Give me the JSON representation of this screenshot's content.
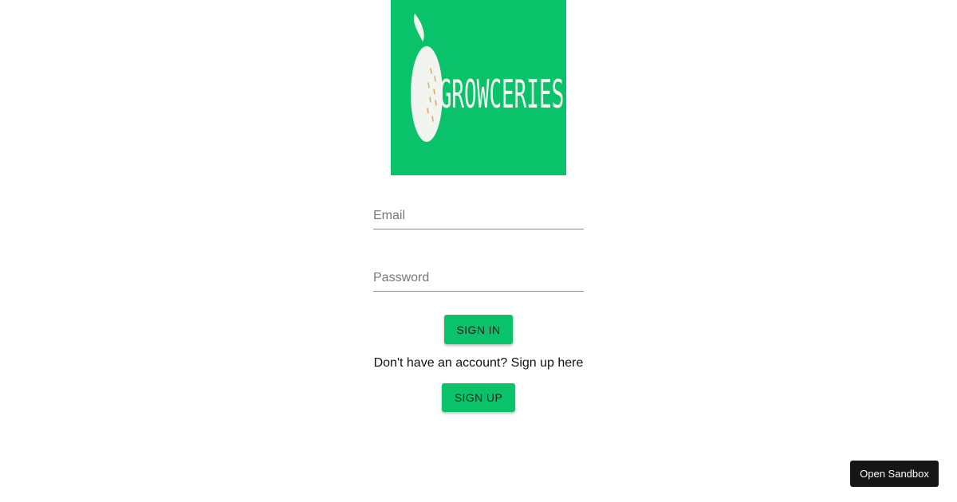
{
  "logo": {
    "wordmark": "GROWCERIES",
    "background": "#0ac26a",
    "icon": "fruit-icon"
  },
  "form": {
    "email_placeholder": "Email",
    "password_placeholder": "Password",
    "signin_label": "SIGN IN",
    "signup_prompt": "Don't have an account? Sign up here",
    "signup_label": "SIGN UP"
  },
  "sandbox": {
    "label": "Open Sandbox"
  },
  "colors": {
    "accent": "#0ac26a",
    "sandbox_bg": "#151515"
  }
}
